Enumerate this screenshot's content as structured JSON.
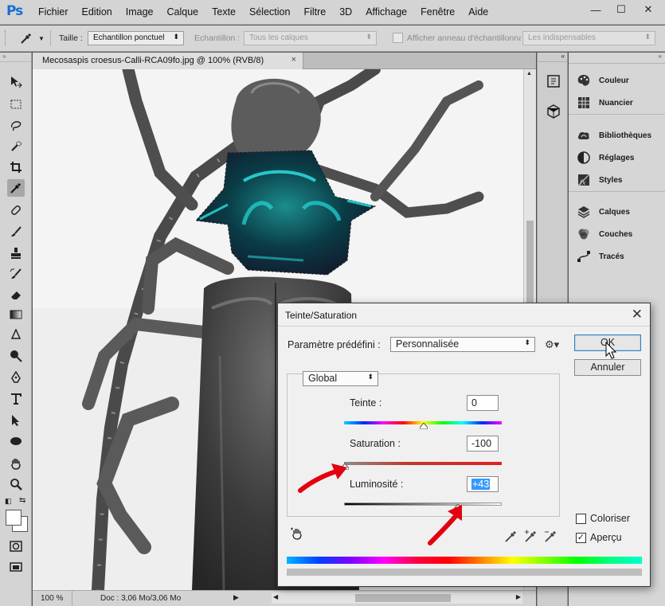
{
  "app": {
    "logo": "Ps",
    "menu": [
      "Fichier",
      "Edition",
      "Image",
      "Calque",
      "Texte",
      "Sélection",
      "Filtre",
      "3D",
      "Affichage",
      "Fenêtre",
      "Aide"
    ],
    "window_buttons": [
      "—",
      "☐",
      "✕"
    ]
  },
  "options_bar": {
    "size_label": "Taille :",
    "size_value": "Echantillon ponctuel",
    "sample_label": "Echantillon :",
    "sample_value": "Tous les calques",
    "ring_label": "Afficher anneau d'échantillonnag",
    "ring_value": "Les indispensables"
  },
  "document": {
    "tab_title": "Mecosaspis croesus-Calli-RCA09fo.jpg @ 100% (RVB/8)",
    "tab_close": "×",
    "zoom": "100 %",
    "doc_info": "Doc : 3,06 Mo/3,06 Mo"
  },
  "panels": {
    "group1": [
      {
        "label": "Couleur",
        "icon": "palette-icon"
      },
      {
        "label": "Nuancier",
        "icon": "swatches-grid-icon"
      }
    ],
    "group2": [
      {
        "label": "Bibliothèques",
        "icon": "libraries-cloud-icon"
      },
      {
        "label": "Réglages",
        "icon": "adjustments-circle-icon"
      },
      {
        "label": "Styles",
        "icon": "styles-fx-icon"
      }
    ],
    "group3": [
      {
        "label": "Calques",
        "icon": "layers-icon"
      },
      {
        "label": "Couches",
        "icon": "channels-icon"
      },
      {
        "label": "Tracés",
        "icon": "paths-icon"
      }
    ]
  },
  "dialog": {
    "title": "Teinte/Saturation",
    "close": "✕",
    "preset_label": "Paramètre prédéfini :",
    "preset_value": "Personnalisée",
    "gear": "⚙▾",
    "ok_label": "OK",
    "cancel_label": "Annuler",
    "channel_value": "Global",
    "hue_label": "Teinte :",
    "hue_value": "0",
    "saturation_label": "Saturation :",
    "saturation_value": "-100",
    "lightness_label": "Luminosité :",
    "lightness_value": "+43",
    "colorize_label": "Coloriser",
    "colorize_checked": false,
    "preview_label": "Aperçu",
    "preview_checked": true,
    "preview_check_mark": "✓",
    "sliders": {
      "hue": 0,
      "saturation": -100,
      "lightness": 43
    }
  },
  "colors": {
    "accent_blue": "#1c6fd1",
    "beetle_teal": "#14c8c8",
    "arrow_red": "#e3000f",
    "selection_highlight": "#3399ff"
  }
}
